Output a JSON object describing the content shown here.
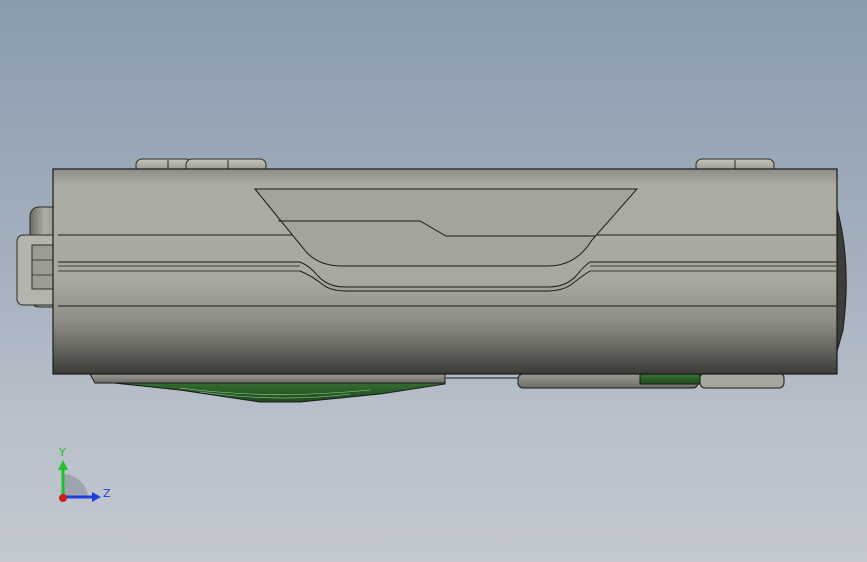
{
  "viewport": {
    "background_top": "#8a9bb0",
    "background_bottom": "#c3c8d0"
  },
  "model": {
    "body_color": "#a9a99f",
    "edge_color": "#1a1a1a",
    "pcb_color": "#2e6b2e"
  },
  "triad": {
    "y_label": "Y",
    "z_label": "Z",
    "y_color": "#22c02a",
    "z_color": "#1f3fd8",
    "x_color": "#d11a1a"
  }
}
